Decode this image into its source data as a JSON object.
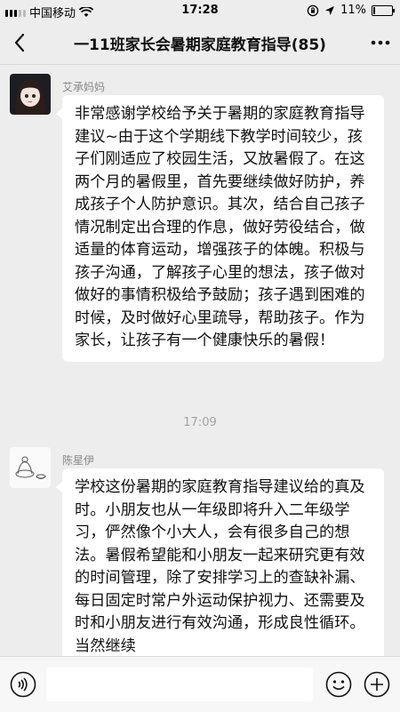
{
  "status": {
    "carrier": "中国移动",
    "time": "17:28",
    "battery": "11%",
    "battery_level": 0.11
  },
  "nav": {
    "title": "一11班家长会暑期家庭教育指导(85)"
  },
  "messages": [
    {
      "sender": "艾承妈妈",
      "text": "非常感谢学校给予关于暑期的家庭教育指导建议~由于这个学期线下教学时间较少，孩子们刚适应了校园生活，又放暑假了。在这两个月的暑假里，首先要继续做好防护，养成孩子个人防护意识。其次，结合自己孩子情况制定出合理的作息，做好劳役结合，做适量的体育运动，增强孩子的体魄。积极与孩子沟通，了解孩子心里的想法，孩子做对做好的事情积极给予鼓励；孩子遇到困难的时候，及时做好心里疏导，帮助孩子。作为家长，让孩子有一个健康快乐的暑假！"
    },
    {
      "sender": "陈星伊",
      "text": "学校这份暑期的家庭教育指导建议给的真及时。小朋友也从一年级即将升入二年级学习，俨然像个小大人，会有很多自己的想法。暑假希望能和小朋友一起来研究更有效的时间管理，除了安排学习上的查缺补漏、每日固定时常户外运动保护视力、还需要及时和小朋友进行有效沟通，形成良性循环。当然继续"
    }
  ],
  "time_separator": "17:09",
  "colors": {
    "background": "#ededed",
    "bubble": "#ffffff",
    "sender": "#888888",
    "separator": "#a3a3a3"
  },
  "icons": {
    "back": "chevron-left-icon",
    "more": "more-dots-icon",
    "voice": "voice-icon",
    "emoji": "emoji-icon",
    "plus": "plus-icon",
    "wifi": "wifi-icon",
    "location": "location-icon",
    "lock": "rotation-lock-icon"
  }
}
